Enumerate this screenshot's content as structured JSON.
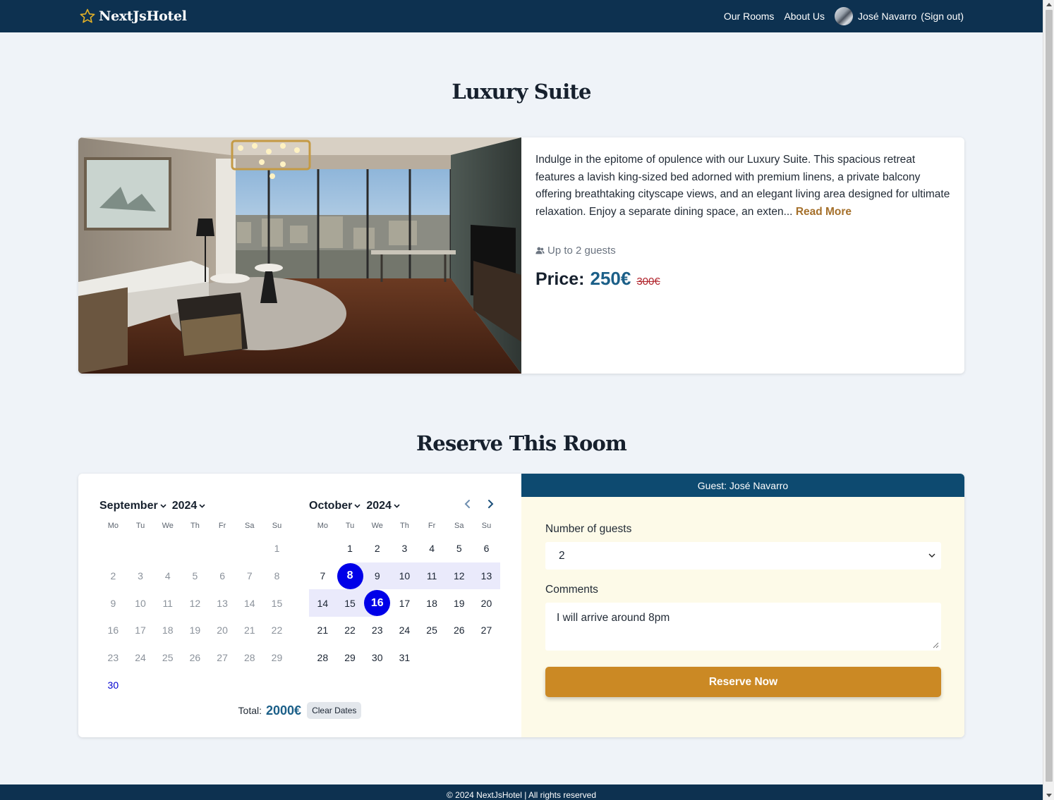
{
  "nav": {
    "brand": "NextJsHotel",
    "links": [
      "Our Rooms",
      "About Us"
    ],
    "user_name": "José Navarro",
    "signout": "(Sign out)"
  },
  "room": {
    "title": "Luxury Suite",
    "description": "Indulge in the epitome of opulence with our Luxury Suite. This spacious retreat features a lavish king-sized bed adorned with premium linens, a private balcony offering breathtaking cityscape views, and an elegant living area designed for ultimate relaxation. Enjoy a separate dining space, an exten...",
    "read_more": "Read More",
    "guests": "Up to 2 guests",
    "price_label": "Price:",
    "price": "250€",
    "old_price": "300€"
  },
  "reserve": {
    "title": "Reserve This Room",
    "calendar": {
      "weekdays": [
        "Mo",
        "Tu",
        "We",
        "Th",
        "Fr",
        "Sa",
        "Su"
      ],
      "months": [
        {
          "month": "September",
          "year": "2024",
          "weeks": [
            [
              "",
              "",
              "",
              "",
              "",
              "",
              "1"
            ],
            [
              "2",
              "3",
              "4",
              "5",
              "6",
              "7",
              "8"
            ],
            [
              "9",
              "10",
              "11",
              "12",
              "13",
              "14",
              "15"
            ],
            [
              "16",
              "17",
              "18",
              "19",
              "20",
              "21",
              "22"
            ],
            [
              "23",
              "24",
              "25",
              "26",
              "27",
              "28",
              "29"
            ],
            [
              "30",
              "",
              "",
              "",
              "",
              "",
              ""
            ]
          ]
        },
        {
          "month": "October",
          "year": "2024",
          "weeks": [
            [
              "",
              "1",
              "2",
              "3",
              "4",
              "5",
              "6"
            ],
            [
              "7",
              "8",
              "9",
              "10",
              "11",
              "12",
              "13"
            ],
            [
              "14",
              "15",
              "16",
              "17",
              "18",
              "19",
              "20"
            ],
            [
              "21",
              "22",
              "23",
              "24",
              "25",
              "26",
              "27"
            ],
            [
              "28",
              "29",
              "30",
              "31",
              "",
              "",
              ""
            ]
          ]
        }
      ],
      "selected_start": "8",
      "selected_end": "16",
      "today": "30"
    },
    "total_label": "Total:",
    "total_value": "2000€",
    "clear_dates": "Clear Dates",
    "guest_header": "Guest: José Navarro",
    "guests_label": "Number of guests",
    "guests_value": "2",
    "comments_label": "Comments",
    "comments_value": "I will arrive around 8pm",
    "reserve_button": "Reserve Now"
  },
  "footer": {
    "text": "© 2024 NextJsHotel | All rights reserved"
  },
  "colors": {
    "nav_bg": "#0d3150",
    "accent_blue": "#1b5f88",
    "selected_day": "#0000e8",
    "range_bg": "#eaeafb",
    "reserve_button": "#cb8924",
    "form_bg": "#fdfae8",
    "read_more": "#a5702b"
  }
}
